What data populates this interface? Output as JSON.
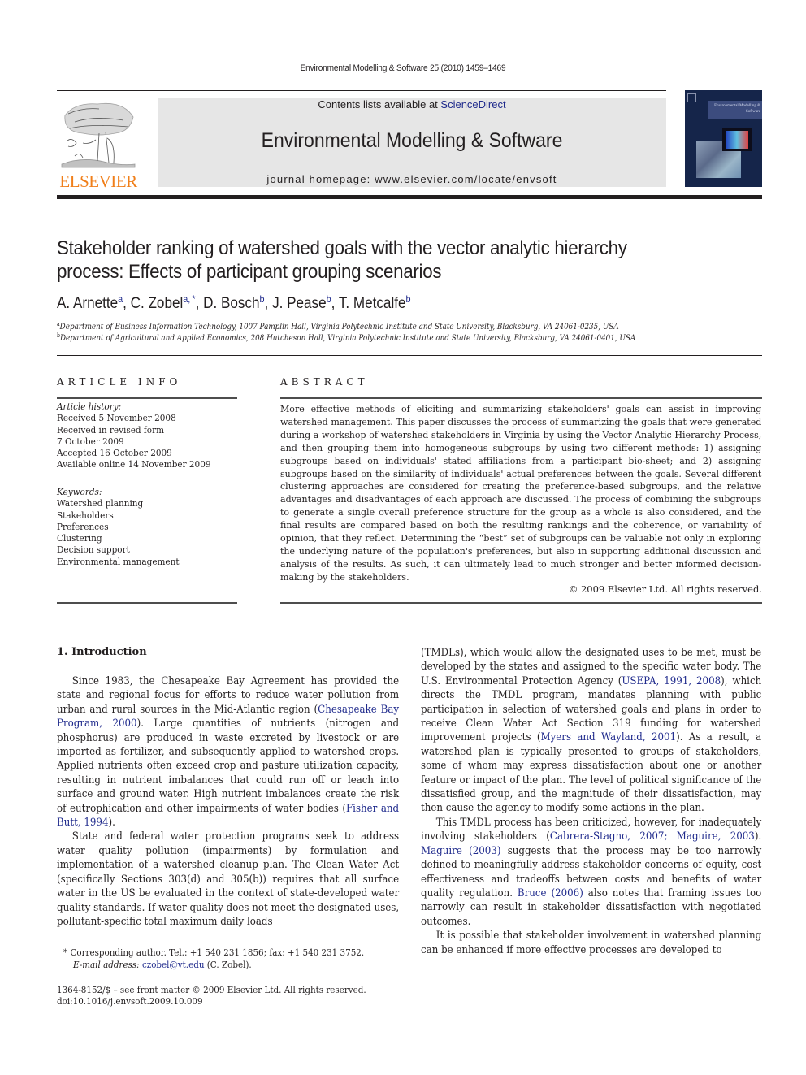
{
  "header": {
    "running_head": "Environmental Modelling & Software 25 (2010) 1459–1469",
    "contents_prefix": "Contents lists available at ",
    "contents_link": "ScienceDirect",
    "journal_name": "Environmental Modelling & Software",
    "homepage": "journal homepage: www.elsevier.com/locate/envsoft",
    "publisher_logo_text": "ELSEVIER",
    "cover_title": "Environmental Modelling & Software",
    "colors": {
      "publisher_orange": "#f07f1a",
      "link_blue": "#1f2a8c",
      "banner_gray": "#e6e6e6",
      "cover_navy": "#15254a"
    }
  },
  "article": {
    "title_line1": "Stakeholder ranking of watershed goals with the vector analytic hierarchy",
    "title_line2": "process: Effects of participant grouping scenarios",
    "authors": [
      {
        "name": "A. Arnette",
        "sup": "a",
        "sep": ", "
      },
      {
        "name": "C. Zobel",
        "sup": "a, *",
        "sep": ", "
      },
      {
        "name": "D. Bosch",
        "sup": "b",
        "sep": ", "
      },
      {
        "name": "J. Pease",
        "sup": "b",
        "sep": ", "
      },
      {
        "name": "T. Metcalfe",
        "sup": "b",
        "sep": ""
      }
    ],
    "affiliations": [
      {
        "mark": "a",
        "text": "Department of Business Information Technology, 1007 Pamplin Hall, Virginia Polytechnic Institute and State University, Blacksburg, VA 24061-0235, USA"
      },
      {
        "mark": "b",
        "text": "Department of Agricultural and Applied Economics, 208 Hutcheson Hall, Virginia Polytechnic Institute and State University, Blacksburg, VA 24061-0401, USA"
      }
    ]
  },
  "article_info": {
    "heading": "ARTICLE INFO",
    "history_label": "Article history:",
    "history": [
      "Received 5 November 2008",
      "Received in revised form",
      "7 October 2009",
      "Accepted 16 October 2009",
      "Available online 14 November 2009"
    ],
    "keywords_label": "Keywords:",
    "keywords": [
      "Watershed planning",
      "Stakeholders",
      "Preferences",
      "Clustering",
      "Decision support",
      "Environmental management"
    ]
  },
  "abstract": {
    "heading": "ABSTRACT",
    "text": "More effective methods of eliciting and summarizing stakeholders' goals can assist in improving watershed management. This paper discusses the process of summarizing the goals that were generated during a workshop of watershed stakeholders in Virginia by using the Vector Analytic Hierarchy Process, and then grouping them into homogeneous subgroups by using two different methods: 1) assigning subgroups based on individuals' stated affiliations from a participant bio-sheet; and 2) assigning subgroups based on the similarity of individuals' actual preferences between the goals. Several different clustering approaches are considered for creating the preference-based subgroups, and the relative advantages and disadvantages of each approach are discussed. The process of combining the subgroups to generate a single overall preference structure for the group as a whole is also considered, and the final results are compared based on both the resulting rankings and the coherence, or variability of opinion, that they reflect. Determining the “best” set of subgroups can be valuable not only in exploring the underlying nature of the population's preferences, but also in supporting additional discussion and analysis of the results. As such, it can ultimately lead to much stronger and better informed decision-making by the stakeholders.",
    "copyright": "© 2009 Elsevier Ltd. All rights reserved."
  },
  "body": {
    "section_heading": "1.  Introduction",
    "left": {
      "p1_a": "Since 1983, the Chesapeake Bay Agreement has provided the state and regional focus for efforts to reduce water pollution from urban and rural sources in the Mid-Atlantic region (",
      "p1_link1": "Chesapeake Bay Program, 2000",
      "p1_b": "). Large quantities of nutrients (nitrogen and phosphorus) are produced in waste excreted by livestock or are imported as fertilizer, and subsequently applied to watershed crops. Applied nutrients often exceed crop and pasture utilization capacity, resulting in nutrient imbalances that could run off or leach into surface and ground water. High nutrient imbalances create the risk of eutrophication and other impairments of water bodies (",
      "p1_link2": "Fisher and Butt, 1994",
      "p1_c": ").",
      "p2": "State and federal water protection programs seek to address water quality pollution (impairments) by formulation and implementation of a watershed cleanup plan. The Clean Water Act (specifically Sections 303(d) and 305(b)) requires that all surface water in the US be evaluated in the context of state-developed water quality standards. If water quality does not meet the designated uses, pollutant-specific total maximum daily loads"
    },
    "right": {
      "p1_a": "(TMDLs), which would allow the designated uses to be met, must be developed by the states and assigned to the specific water body. The U.S. Environmental Protection Agency (",
      "p1_link1": "USEPA, 1991, 2008",
      "p1_b": "), which directs the TMDL program, mandates planning with public participation in selection of watershed goals and plans in order to receive Clean Water Act Section 319 funding for watershed improvement projects (",
      "p1_link2": "Myers and Wayland, 2001",
      "p1_c": "). As a result, a watershed plan is typically presented to groups of stakeholders, some of whom may express dissatisfaction about one or another feature or impact of the plan. The level of political significance of the dissatisfied group, and the magnitude of their dissatisfaction, may then cause the agency to modify some actions in the plan.",
      "p2_a": "This TMDL process has been criticized, however, for inadequately involving stakeholders (",
      "p2_link1": "Cabrera-Stagno, 2007; Maguire, 2003",
      "p2_b": "). ",
      "p2_link2": "Maguire (2003)",
      "p2_c": " suggests that the process may be too narrowly defined to meaningfully address stakeholder concerns of equity, cost effectiveness and tradeoffs between costs and benefits of water quality regulation. ",
      "p2_link3": "Bruce (2006)",
      "p2_d": " also notes that framing issues too narrowly can result in stakeholder dissatisfaction with negotiated outcomes.",
      "p3": "It is possible that stakeholder involvement in watershed planning can be enhanced if more effective processes are developed to"
    }
  },
  "footnotes": {
    "corresponding": "*  Corresponding author. Tel.: +1 540 231 1856; fax: +1 540 231 3752.",
    "email_label": "E-mail address: ",
    "email": "czobel@vt.edu",
    "email_suffix": " (C. Zobel).",
    "issn": "1364-8152/$ – see front matter © 2009 Elsevier Ltd. All rights reserved.",
    "doi": "doi:10.1016/j.envsoft.2009.10.009"
  }
}
